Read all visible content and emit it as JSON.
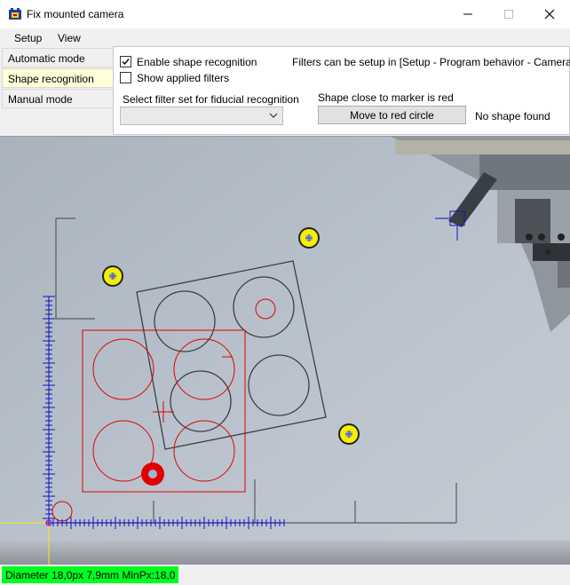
{
  "window": {
    "title": "Fix mounted camera"
  },
  "menu": {
    "items": [
      "Setup",
      "View"
    ]
  },
  "modes": [
    {
      "label": "Automatic mode",
      "active": false
    },
    {
      "label": "Shape recognition",
      "active": true
    },
    {
      "label": "Manual mode",
      "active": false
    }
  ],
  "panel": {
    "enable_shape_recognition": {
      "label": "Enable shape recognition",
      "checked": true
    },
    "show_applied_filters": {
      "label": "Show applied filters",
      "checked": false
    },
    "filters_info": "Filters can be setup in [Setup - Program behavior - Camera]",
    "filter_set_label": "Select filter set for fiducial recognition",
    "filter_set_value": "",
    "shape_close_label": "Shape close to marker is red",
    "move_button": "Move to red circle",
    "shape_status": "No shape found"
  },
  "status": {
    "text": "Diameter 18,0px 7,9mm   MinPx:18,0",
    "color": "#00ff21"
  },
  "colors": {
    "accent_red": "#e00000",
    "marker_yellow": "#f5f000",
    "ruler_blue": "#1010c0"
  }
}
